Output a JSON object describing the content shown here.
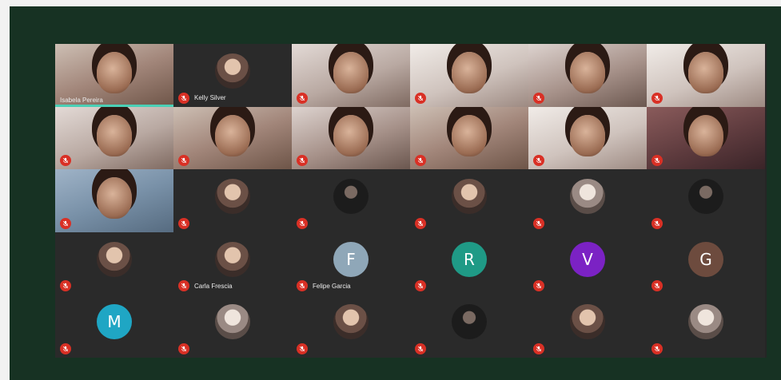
{
  "participants": [
    {
      "name": "Isabela Pereira",
      "kind": "video",
      "tone": "v1",
      "speaking": true,
      "muted": false
    },
    {
      "name": "Kelly Silver",
      "kind": "avatar",
      "avatar": "photo",
      "muted": true
    },
    {
      "name": "",
      "kind": "video",
      "tone": "v2",
      "muted": true
    },
    {
      "name": "",
      "kind": "video",
      "tone": "v3",
      "muted": true
    },
    {
      "name": "",
      "kind": "video",
      "tone": "v5",
      "muted": true
    },
    {
      "name": "",
      "kind": "video",
      "tone": "v3",
      "muted": true
    },
    {
      "name": "",
      "kind": "video",
      "tone": "v2",
      "muted": true
    },
    {
      "name": "",
      "kind": "video",
      "tone": "v1",
      "muted": true
    },
    {
      "name": "",
      "kind": "video",
      "tone": "v5",
      "muted": true
    },
    {
      "name": "",
      "kind": "video",
      "tone": "v1",
      "muted": true
    },
    {
      "name": "",
      "kind": "video",
      "tone": "v3",
      "muted": true
    },
    {
      "name": "",
      "kind": "video",
      "tone": "v4",
      "muted": true
    },
    {
      "name": "",
      "kind": "video",
      "tone": "v6",
      "muted": true
    },
    {
      "name": "",
      "kind": "avatar",
      "avatar": "photo",
      "muted": true
    },
    {
      "name": "",
      "kind": "avatar",
      "avatar": "dark",
      "muted": true
    },
    {
      "name": "",
      "kind": "avatar",
      "avatar": "photo",
      "muted": true
    },
    {
      "name": "",
      "kind": "avatar",
      "avatar": "light",
      "muted": true
    },
    {
      "name": "",
      "kind": "avatar",
      "avatar": "dark",
      "muted": true
    },
    {
      "name": "",
      "kind": "avatar",
      "avatar": "photo",
      "muted": true
    },
    {
      "name": "Carla Frescia",
      "kind": "avatar",
      "avatar": "photo",
      "muted": true
    },
    {
      "name": "Felipe Garcia",
      "kind": "avatar",
      "avatar": "letter",
      "letter": "F",
      "color": "#8fa7b8",
      "muted": true
    },
    {
      "name": "",
      "kind": "avatar",
      "avatar": "letter",
      "letter": "R",
      "color": "#1f9a86",
      "muted": true
    },
    {
      "name": "",
      "kind": "avatar",
      "avatar": "letter",
      "letter": "V",
      "color": "#7b22c4",
      "muted": true
    },
    {
      "name": "",
      "kind": "avatar",
      "avatar": "letter",
      "letter": "G",
      "color": "#6d4b3e",
      "muted": true
    },
    {
      "name": "",
      "kind": "avatar",
      "avatar": "letter",
      "letter": "M",
      "color": "#1fa6c4",
      "muted": true
    },
    {
      "name": "",
      "kind": "avatar",
      "avatar": "light",
      "muted": true
    },
    {
      "name": "",
      "kind": "avatar",
      "avatar": "photo",
      "muted": true
    },
    {
      "name": "",
      "kind": "avatar",
      "avatar": "dark",
      "muted": true
    },
    {
      "name": "",
      "kind": "avatar",
      "avatar": "photo",
      "muted": true
    },
    {
      "name": "",
      "kind": "avatar",
      "avatar": "light",
      "muted": true
    }
  ],
  "colors": {
    "background": "#173223",
    "tile": "#2a2a2a",
    "mute": "#d93025",
    "speaking": "#4bd0b6"
  }
}
